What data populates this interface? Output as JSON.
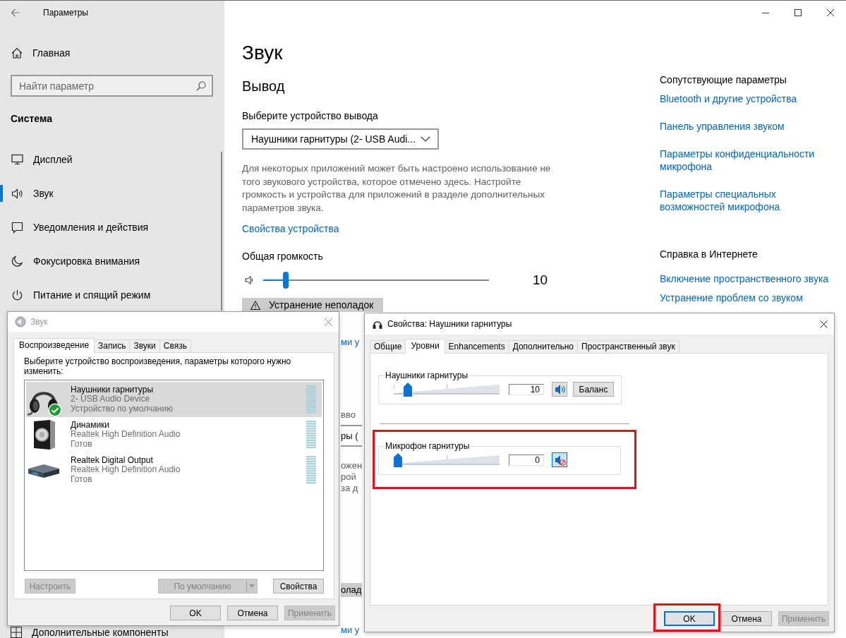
{
  "settings_window": {
    "title": "Параметры",
    "sidebar": {
      "home": "Главная",
      "search": {
        "placeholder": "Найти параметр"
      },
      "section": "Система",
      "items": [
        {
          "label": "Дисплей",
          "selected": false
        },
        {
          "label": "Звук",
          "selected": true
        },
        {
          "label": "Уведомления и действия",
          "selected": false
        },
        {
          "label": "Фокусировка внимания",
          "selected": false
        },
        {
          "label": "Питание и спящий режим",
          "selected": false
        }
      ],
      "lower_item": "Дополнительные компоненты"
    },
    "page": {
      "title": "Звук",
      "output": {
        "heading": "Вывод",
        "device_label": "Выберите устройство вывода",
        "device_dropdown": "Наушники гарнитуры (2- USB Audi...",
        "description": "Для некоторых приложений может быть настроено использование не того звукового устройства, которое отмечено здесь. Настройте громкость и устройства для приложений в разделе дополнительных параметров звука.",
        "properties_link": "Свойства устройства",
        "volume_label": "Общая громкость",
        "volume": {
          "level": 0.1,
          "reading": "10"
        },
        "troubleshoot_button": "Устранение неполадок"
      },
      "covered_fragments": [
        {
          "kind": "link",
          "text": "ми у"
        },
        {
          "kind": "text",
          "text": "вво"
        },
        {
          "kind": "field",
          "text": "ры ("
        },
        {
          "kind": "text",
          "text": "ожен"
        },
        {
          "kind": "text",
          "text": "рой"
        },
        {
          "kind": "text",
          "text": "за д"
        },
        {
          "kind": "button",
          "text": "олад"
        },
        {
          "kind": "link",
          "text": "ми у"
        }
      ]
    },
    "related": {
      "heading": "Сопутствующие параметры",
      "links": [
        "Bluetooth и другие устройства",
        "Панель управления звуком",
        "Параметры конфиденциальности микрофона",
        "Параметры специальных возможностей микрофона"
      ]
    },
    "help": {
      "heading": "Справка в Интернете",
      "links": [
        "Включение пространственного звука",
        "Устранение проблем со звуком"
      ]
    }
  },
  "sound_dialog": {
    "title": "Звук",
    "active": false,
    "tabs": [
      {
        "label": "Воспроизведение",
        "selected": true
      },
      {
        "label": "Запись",
        "selected": false
      },
      {
        "label": "Звуки",
        "selected": false
      },
      {
        "label": "Связь",
        "selected": false
      }
    ],
    "instruction": "Выберите устройство воспроизведения, параметры которого нужно изменить:",
    "devices": [
      {
        "name": "Наушники гарнитуры",
        "driver": "2- USB Audio Device",
        "status": "Устройство по умолчанию",
        "selected": true,
        "default": true
      },
      {
        "name": "Динамики",
        "driver": "Realtek High Definition Audio",
        "status": "Готов",
        "selected": false,
        "default": false
      },
      {
        "name": "Realtek Digital Output",
        "driver": "Realtek High Definition Audio",
        "status": "Готов",
        "selected": false,
        "default": false
      }
    ],
    "actions": [
      {
        "label": "Настроить",
        "kind": "plain",
        "disabled": true
      },
      {
        "label": "По умолчанию",
        "kind": "split",
        "disabled": true
      },
      {
        "label": "Свойства",
        "kind": "plain",
        "disabled": false
      }
    ],
    "buttons": [
      {
        "label": "OK",
        "disabled": false
      },
      {
        "label": "Отмена",
        "disabled": false
      },
      {
        "label": "Применить",
        "disabled": true
      }
    ]
  },
  "properties_dialog": {
    "title": "Свойства: Наушники гарнитуры",
    "active": true,
    "tabs": [
      {
        "label": "Общие",
        "selected": false
      },
      {
        "label": "Уровни",
        "selected": true
      },
      {
        "label": "Enhancements",
        "selected": false
      },
      {
        "label": "Дополнительно",
        "selected": false
      },
      {
        "label": "Пространственный звук",
        "selected": false
      }
    ],
    "levels": [
      {
        "label": "Наушники гарнитуры",
        "level": 0.1,
        "value": "10",
        "muted": false,
        "highlighted": false,
        "balance_button": "Баланс"
      },
      {
        "label": "Микрофон гарнитуры",
        "level": 0,
        "value": "0",
        "muted": true,
        "highlighted": true
      }
    ],
    "buttons": [
      {
        "label": "OK",
        "disabled": false,
        "focused": true,
        "highlighted": true
      },
      {
        "label": "Отмена",
        "disabled": false,
        "focused": false,
        "highlighted": false
      },
      {
        "label": "Применить",
        "disabled": true,
        "focused": false,
        "highlighted": false
      }
    ]
  }
}
